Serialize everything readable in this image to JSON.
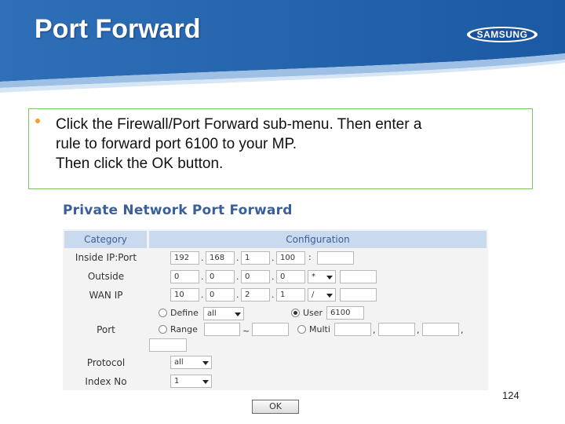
{
  "slide": {
    "title": "Port Forward",
    "logo_text": "SAMSUNG",
    "page_number": "124"
  },
  "instructions": {
    "lines": [
      "Click the Firewall/Port Forward sub-menu. Then enter a",
      "rule to forward port 6100 to your MP.",
      "Then click the OK button."
    ]
  },
  "form": {
    "title": "Private Network Port Forward",
    "headers": {
      "category": "Category",
      "configuration": "Configuration"
    },
    "rows": {
      "inside": {
        "label": "Inside IP:Port",
        "ip": [
          "192",
          "168",
          "1",
          "100"
        ],
        "port": ""
      },
      "outside": {
        "label": "Outside",
        "ip": [
          "0",
          "0",
          "0",
          "0"
        ],
        "mask": "*",
        "extra": ""
      },
      "wan": {
        "label": "WAN IP",
        "ip": [
          "10",
          "0",
          "2",
          "1"
        ],
        "mask": "/",
        "extra": ""
      },
      "port": {
        "label": "Port",
        "define_label": "Define",
        "define_value": "all",
        "range_label": "Range",
        "range_sep": "~",
        "user_label": "User",
        "user_value": "6100",
        "multi_label": "Multi"
      },
      "protocol": {
        "label": "Protocol",
        "value": "all"
      },
      "index": {
        "label": "Index No",
        "value": "1"
      }
    },
    "ok_label": "OK"
  },
  "colors": {
    "header_blue": "#1e5fa8",
    "instruction_border": "#7cc46a",
    "bullet": "#f0a030",
    "form_title": "#3b5f9b",
    "table_header_bg": "#c9d9ee"
  }
}
